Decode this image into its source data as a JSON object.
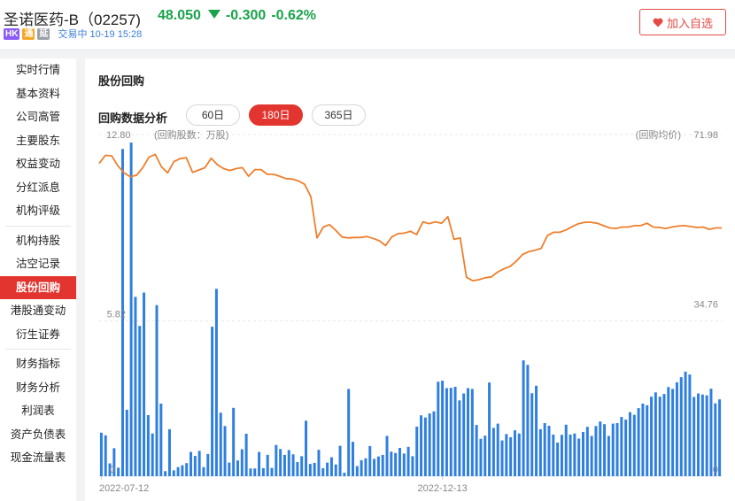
{
  "header": {
    "stock_name": "圣诺医药-B（02257)",
    "price": "48.050",
    "change": "-0.300",
    "change_pct": "-0.62%",
    "tags": [
      "HK",
      "通",
      "延"
    ],
    "trade_status": "交易中 10-19 15:28",
    "watch_button": "加入自选",
    "colors": {
      "down": "#1aa34a",
      "accent": "#e3352f"
    }
  },
  "sidebar": {
    "groups": [
      [
        "实时行情",
        "基本资料",
        "公司高管",
        "主要股东",
        "权益变动",
        "分红派息",
        "机构评级"
      ],
      [
        "机构持股",
        "沽空记录",
        "股份回购",
        "港股通变动",
        "衍生证券"
      ],
      [
        "财务指标",
        "财务分析",
        "利润表",
        "资产负债表",
        "现金流量表"
      ]
    ],
    "active": "股份回购"
  },
  "main": {
    "section_title": "股份回购",
    "subtitle": "回购数据分析",
    "tabs": [
      "60日",
      "180日",
      "365日"
    ],
    "active_tab": "180日"
  },
  "chart_data": {
    "type": "bar+line",
    "left_axis_label": "(回购股数：万股)",
    "right_axis_label": "(回购均价)",
    "left_ticks": [
      "12.80",
      "5.82",
      "0"
    ],
    "right_ticks": [
      "71.98",
      "34.76",
      "0"
    ],
    "left_ylim": [
      0,
      12.8
    ],
    "right_ylim": [
      0,
      71.98
    ],
    "x_labels": [
      {
        "label": "2022-07-12",
        "index": 0
      },
      {
        "label": "2022-12-13",
        "index": 80
      }
    ],
    "series": [
      {
        "name": "回购股数",
        "kind": "bar",
        "color": "#2f7fe0",
        "values": [
          1.63,
          1.53,
          0.48,
          1.05,
          0.32,
          12.26,
          2.49,
          12.5,
          6.72,
          5.63,
          6.88,
          2.29,
          1.6,
          6.41,
          2.72,
          0.19,
          1.76,
          0.22,
          0.34,
          0.41,
          0.49,
          0.91,
          0.76,
          0.95,
          0.34,
          0.83,
          5.6,
          7.02,
          2.38,
          1.88,
          0.51,
          2.56,
          0.59,
          1.01,
          1.59,
          0.29,
          0.29,
          0.91,
          0.3,
          0.8,
          0.31,
          1.17,
          1.02,
          0.8,
          0.98,
          0.82,
          0.53,
          0.75,
          2.08,
          0.46,
          0.5,
          0.99,
          0.3,
          0.51,
          0.71,
          0.44,
          1.14,
          0.13,
          3.27,
          1.29,
          0.38,
          0.6,
          0.67,
          1.13,
          0.65,
          0.74,
          0.8,
          1.51,
          0.92,
          0.87,
          1.06,
          0.85,
          1.1,
          0.75,
          1.86,
          2.28,
          2.2,
          2.35,
          2.43,
          3.54,
          3.58,
          3.3,
          3.31,
          3.35,
          2.84,
          3.1,
          3.3,
          3.27,
          1.92,
          1.4,
          1.52,
          3.51,
          1.81,
          1.97,
          1.34,
          1.58,
          1.46,
          1.72,
          1.6,
          4.34,
          4.17,
          3.11,
          3.39,
          1.76,
          1.99,
          1.89,
          1.56,
          1.26,
          1.55,
          1.93,
          1.56,
          1.6,
          1.41,
          1.66,
          1.85,
          1.51,
          1.88,
          2.05,
          1.95,
          1.51,
          1.97,
          1.99,
          2.22,
          2.12,
          2.4,
          2.3,
          2.55,
          2.72,
          2.66,
          2.98,
          3.14,
          2.98,
          3.08,
          3.34,
          3.27,
          3.52,
          3.71,
          3.92,
          3.81,
          2.97,
          3.1,
          3.06,
          3.03,
          3.28,
          2.73,
          2.88
        ]
      },
      {
        "name": "回购均价",
        "kind": "line",
        "color": "#ee7f2d",
        "values": [
          65.9,
          67.6,
          67.5,
          65.4,
          63.9,
          63.1,
          63.4,
          65.0,
          67.2,
          67.8,
          65.2,
          63.9,
          66.3,
          66.9,
          67.1,
          64.0,
          64.5,
          65.0,
          67.0,
          65.6,
          64.8,
          64.4,
          64.8,
          65.0,
          63.2,
          64.6,
          64.6,
          63.6,
          63.6,
          63.2,
          62.7,
          62.6,
          62.2,
          61.5,
          58.9,
          50.2,
          52.5,
          53.0,
          51.8,
          50.4,
          50.2,
          50.3,
          50.3,
          50.5,
          50.1,
          49.6,
          48.6,
          50.4,
          51.1,
          51.2,
          51.6,
          50.9,
          53.6,
          53.2,
          53.6,
          53.3,
          54.7,
          49.9,
          50.2,
          41.9,
          41.2,
          41.4,
          41.8,
          42.0,
          43.0,
          43.7,
          44.2,
          45.3,
          46.7,
          47.3,
          47.6,
          48.0,
          50.7,
          51.4,
          51.4,
          51.9,
          52.6,
          53.2,
          53.5,
          53.5,
          53.3,
          52.8,
          52.3,
          52.2,
          52.5,
          52.5,
          52.8,
          52.8,
          53.3,
          52.5,
          52.4,
          52.2,
          52.5,
          52.7,
          52.8,
          52.6,
          52.4,
          52.5,
          52.0,
          52.3,
          52.3
        ]
      }
    ],
    "grid": true
  }
}
